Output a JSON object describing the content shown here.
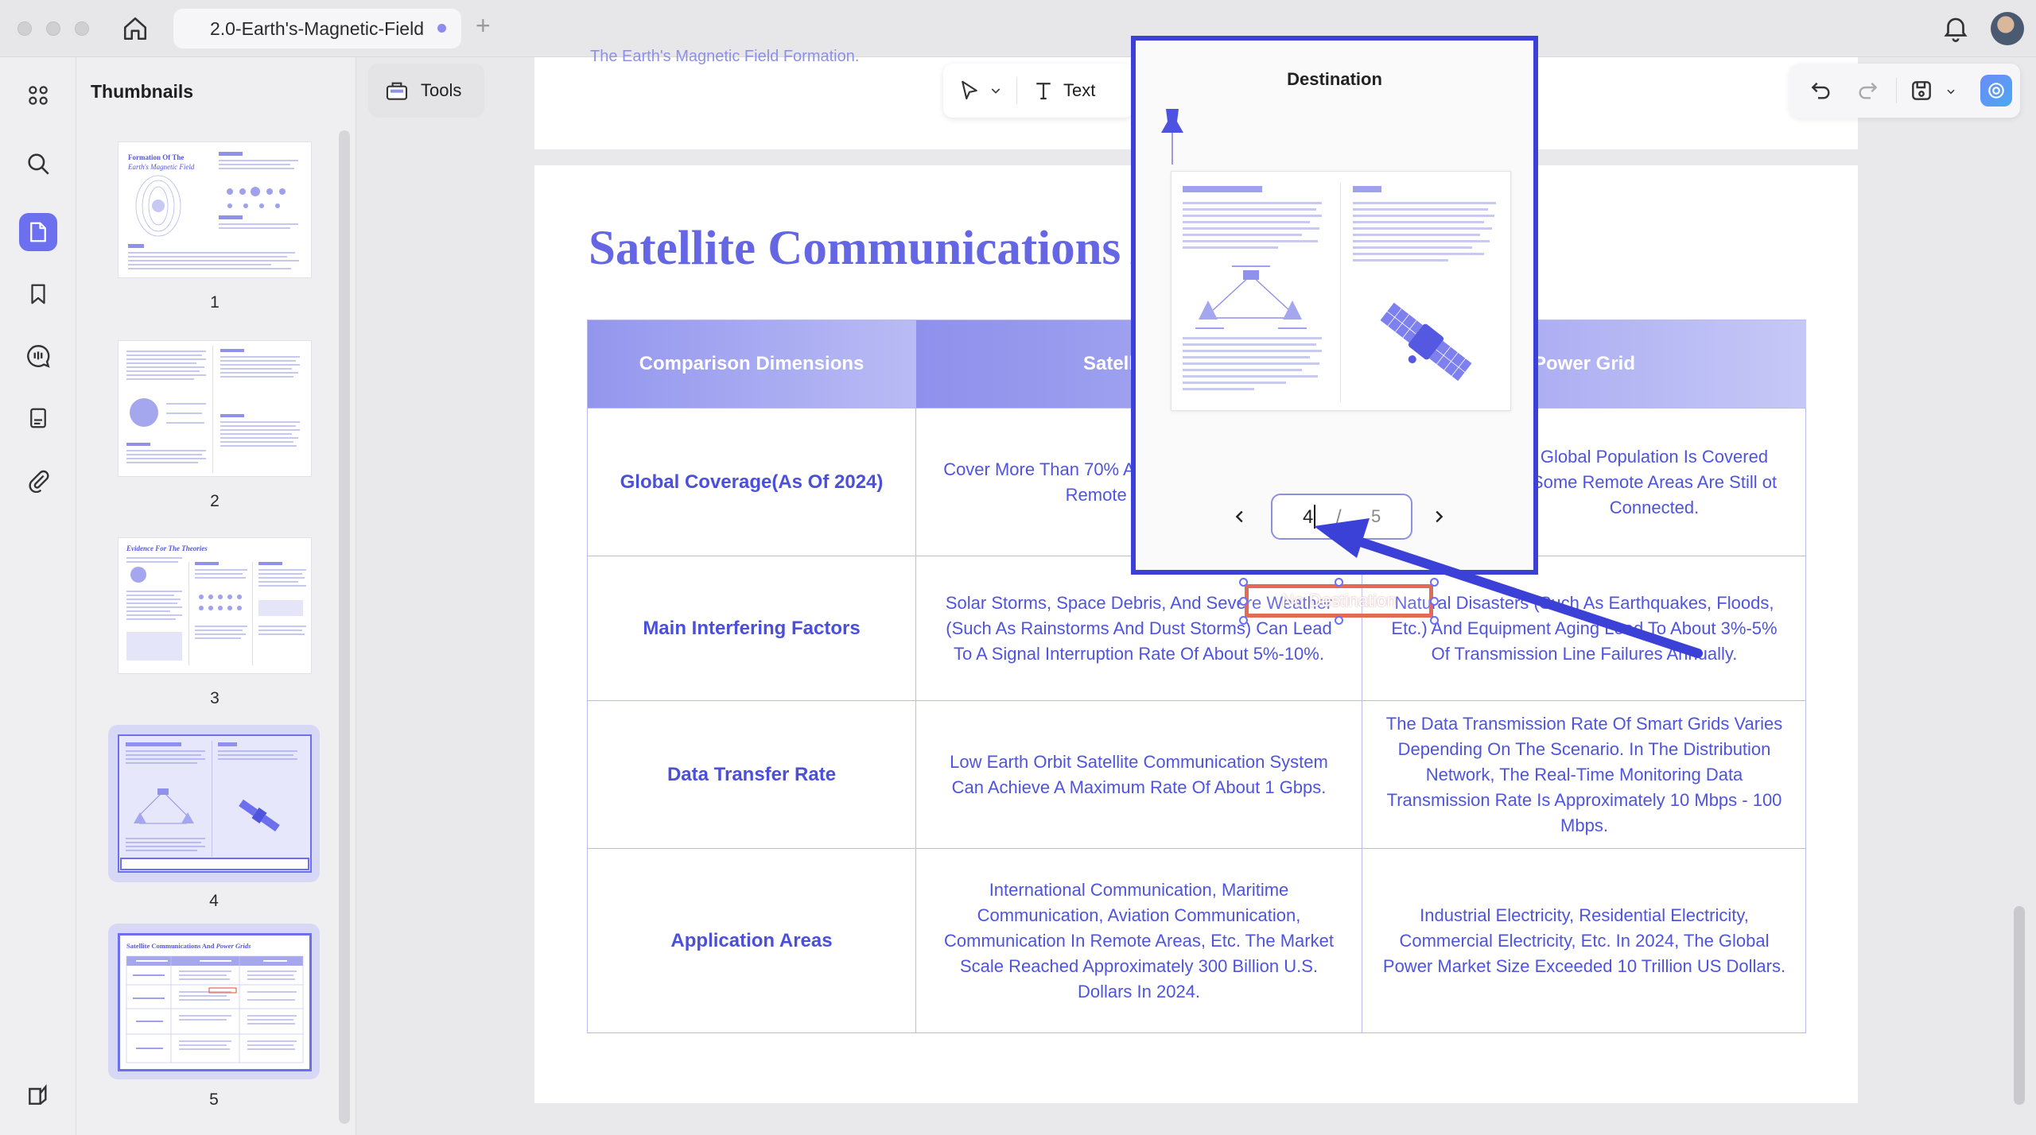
{
  "window": {
    "tab_title": "2.0-Earth's-Magnetic-Field",
    "tab_dirty_color": "#8a8cf0"
  },
  "sidebar": {
    "title": "Thumbnails",
    "pages": [
      "1",
      "2",
      "3",
      "4",
      "5"
    ],
    "selected_page": "5",
    "highlighted_page": "4"
  },
  "toolbar": {
    "tools_label": "Tools",
    "text_label": "Text"
  },
  "document": {
    "prev_page_footer": "The Earth's Magnetic Field Formation.",
    "title": "Satellite Communications A",
    "table": {
      "headers": [
        "Comparison Dimensions",
        "Satellite Cor",
        "Power Grid"
      ],
      "rows": [
        {
          "label": "Global Coverage(As Of 2024)",
          "satellite": "Cover More Than 70% Approximately. The Co And Remote Areas Is C",
          "grid": "Global Population Is Covered Some Remote Areas Are Still ot Connected."
        },
        {
          "label": "Main Interfering Factors",
          "satellite": "Solar Storms, Space Debris, And Severe Weather (Such As Rainstorms And Dust Storms) Can Lead To A Signal Interruption Rate Of About 5%-10%.",
          "grid": "Natural Disasters (Such As Earthquakes, Floods, Etc.) And Equipment Aging Lead To About 3%-5% Of Transmission Line Failures Annually."
        },
        {
          "label": "Data Transfer Rate",
          "satellite": "Low Earth Orbit Satellite Communication System Can Achieve A Maximum Rate Of About 1 Gbps.",
          "grid": "The Data Transmission Rate Of Smart Grids Varies Depending On The Scenario. In The Distribution Network, The Real-Time Monitoring Data Transmission Rate Is Approximately 10 Mbps - 100 Mbps."
        },
        {
          "label": "Application Areas",
          "satellite": "International Communication, Maritime Communication, Aviation Communication, Communication In Remote Areas, Etc. The Market Scale Reached Approximately 300 Billion U.S. Dollars In 2024.",
          "grid": "Industrial Electricity, Residential Electricity, Commercial Electricity, Etc. In 2024, The Global Power Market Size Exceeded 10 Trillion US Dollars."
        }
      ]
    },
    "link_label": "No Destination"
  },
  "popup": {
    "title": "Destination",
    "current_page": "4",
    "separator": "/",
    "total_pages": "5"
  },
  "colors": {
    "accent": "#6c70ee",
    "title": "#6466e3",
    "popup_border": "#3b40d6",
    "link_border": "#e36a54"
  },
  "icons": [
    "home-icon",
    "plus-icon",
    "bell-icon",
    "grid-icon",
    "search-icon",
    "page-icon",
    "bookmark-icon",
    "comment-icon",
    "form-icon",
    "attachment-icon",
    "layers-icon",
    "toolbox-icon",
    "cursor-icon",
    "text-icon",
    "undo-icon",
    "redo-icon",
    "save-icon",
    "ai-icon",
    "pin-icon",
    "chevron-left-icon",
    "chevron-right-icon"
  ]
}
